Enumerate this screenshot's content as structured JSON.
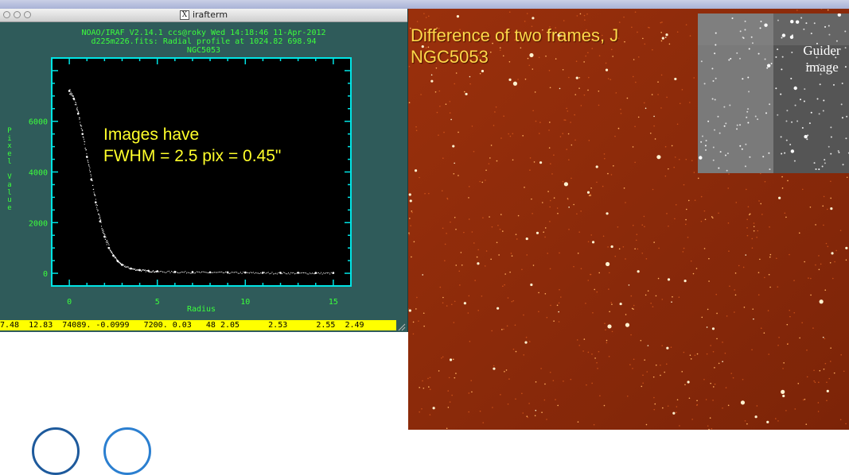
{
  "window": {
    "title": "irafterm",
    "x_icon": "X"
  },
  "plot_header": {
    "line1": "NOAO/IRAF V2.14.1 ccs@roky Wed 14:18:46 11-Apr-2012",
    "line2": "d225m226.fits: Radial profile at 1024.82 698.94",
    "line3": "NGC5053"
  },
  "annotation": {
    "line1": "Images have",
    "line2": "FWHM = 2.5 pix = 0.45\""
  },
  "status_bar": {
    "text": "7.48  12.83  74089. -0.0999   7200. 0.03   48 2.05      2.53      2.55  2.49"
  },
  "image_panel": {
    "caption_line1": "Difference of two frames, J",
    "caption_line2": "NGC5053",
    "guider_label_line1": "Guider",
    "guider_label_line2": "image"
  },
  "colors": {
    "terminal_bg": "#2f5b5a",
    "plot_green": "#3cff3c",
    "axis_cyan": "#00e5e5",
    "annotation_yellow": "#ffff2a",
    "caption_yellow": "#ffd84a",
    "image_red": "#8a2a0a"
  },
  "chart_data": {
    "type": "scatter",
    "title": "NGC5053",
    "xlabel": "Radius",
    "ylabel": "Pixel Value",
    "xlim": [
      -1,
      16
    ],
    "ylim": [
      -500,
      8500
    ],
    "x_ticks": [
      "0",
      "5",
      "10",
      "15"
    ],
    "y_ticks": [
      "0",
      "2000",
      "4000",
      "6000"
    ],
    "x_tick_values": [
      0,
      5,
      10,
      15
    ],
    "y_tick_values": [
      0,
      2000,
      4000,
      6000
    ],
    "grid": false,
    "series": [
      {
        "x": [
          0.0,
          0.25,
          0.5,
          0.75,
          1.0,
          1.25,
          1.5,
          1.75,
          2.0,
          2.25,
          2.5,
          2.75,
          3.0,
          3.5,
          4.0,
          4.5,
          5.0,
          6.0,
          7.0,
          8.0,
          9.0,
          10.0,
          11.0,
          12.0,
          13.0,
          14.0,
          15.0
        ],
        "y": [
          7200,
          6900,
          6300,
          5500,
          4600,
          3700,
          2800,
          2050,
          1450,
          1000,
          700,
          480,
          330,
          190,
          130,
          100,
          80,
          60,
          50,
          40,
          35,
          30,
          25,
          20,
          20,
          15,
          15
        ]
      }
    ]
  }
}
